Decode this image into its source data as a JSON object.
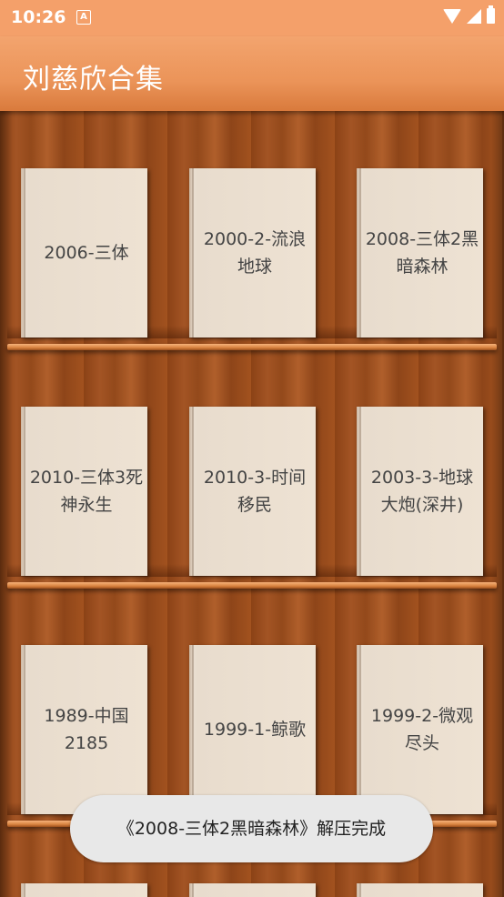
{
  "status_bar": {
    "time": "10:26",
    "notification_icon": "A",
    "icons": [
      "wifi-icon",
      "signal-icon",
      "battery-icon"
    ]
  },
  "app_bar": {
    "title": "刘慈欣合集"
  },
  "books": [
    {
      "title": "2006-三体"
    },
    {
      "title": "2000-2-流浪地球"
    },
    {
      "title": "2008-三体2黑暗森林"
    },
    {
      "title": "2010-三体3死神永生"
    },
    {
      "title": "2010-3-时间移民"
    },
    {
      "title": "2003-3-地球大炮(深井)"
    },
    {
      "title": "1989-中国2185"
    },
    {
      "title": "1999-1-鲸歌"
    },
    {
      "title": "1999-2-微观尽头"
    }
  ],
  "toast": {
    "message": "《2008-三体2黑暗森林》解压完成"
  },
  "colors": {
    "status_bar": "#f4a06a",
    "app_bar": "#eb9459",
    "shelf_wood": "#8b4216",
    "book_cover": "#eee2d3"
  }
}
